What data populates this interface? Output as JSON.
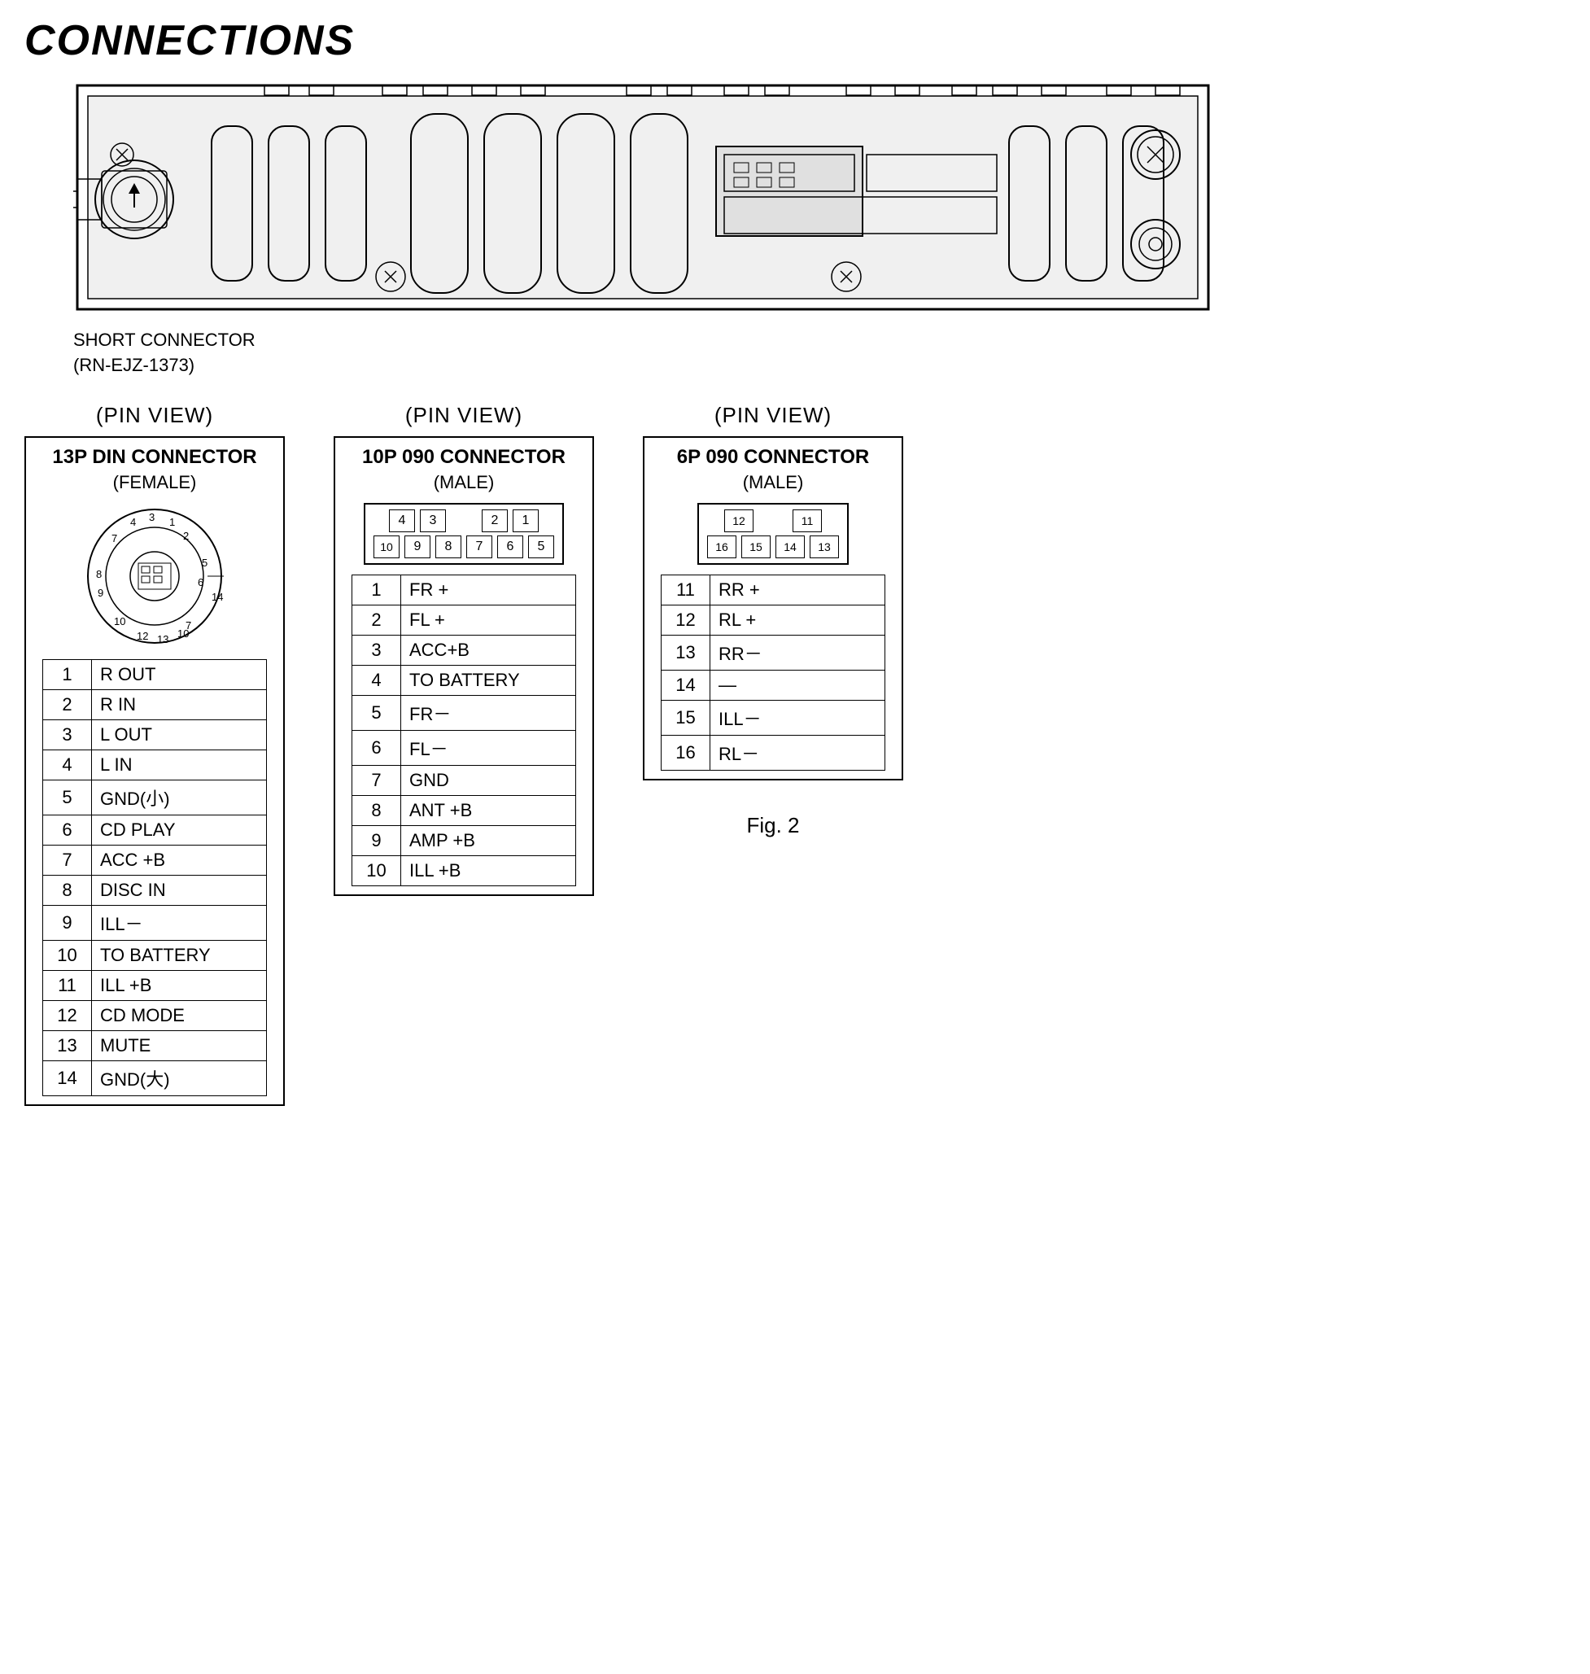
{
  "title": "CONNECTIONS",
  "short_connector_label": "SHORT CONNECTOR",
  "short_connector_code": "(RN-EJZ-1373)",
  "pin_view_label": "(PIN  VIEW)",
  "connector13p": {
    "title": "13P DIN CONNECTOR",
    "subtitle": "(FEMALE)",
    "pins": [
      {
        "num": "1",
        "label": "R OUT"
      },
      {
        "num": "2",
        "label": "R IN"
      },
      {
        "num": "3",
        "label": "L OUT"
      },
      {
        "num": "4",
        "label": "L IN"
      },
      {
        "num": "5",
        "label": "GND(小)"
      },
      {
        "num": "6",
        "label": "CD PLAY"
      },
      {
        "num": "7",
        "label": "ACC +B"
      },
      {
        "num": "8",
        "label": "DISC IN"
      },
      {
        "num": "9",
        "label": "ILL－"
      },
      {
        "num": "10",
        "label": "TO BATTERY"
      },
      {
        "num": "11",
        "label": "ILL +B"
      },
      {
        "num": "12",
        "label": "CD MODE"
      },
      {
        "num": "13",
        "label": "MUTE"
      },
      {
        "num": "14",
        "label": "GND(大)"
      }
    ]
  },
  "connector10p": {
    "title": "10P 090 CONNECTOR",
    "subtitle": "(MALE)",
    "grid_top": [
      "4",
      "3",
      "",
      "2",
      "1"
    ],
    "grid_bottom": [
      "10",
      "9",
      "8",
      "7",
      "6",
      "5"
    ],
    "pins": [
      {
        "num": "1",
        "label": "FR +"
      },
      {
        "num": "2",
        "label": "FL +"
      },
      {
        "num": "3",
        "label": "ACC+B"
      },
      {
        "num": "4",
        "label": "TO BATTERY"
      },
      {
        "num": "5",
        "label": "FR－"
      },
      {
        "num": "6",
        "label": "FL－"
      },
      {
        "num": "7",
        "label": "GND"
      },
      {
        "num": "8",
        "label": "ANT +B"
      },
      {
        "num": "9",
        "label": "AMP +B"
      },
      {
        "num": "10",
        "label": "ILL +B"
      }
    ]
  },
  "connector6p": {
    "title": "6P 090 CONNECTOR",
    "subtitle": "(MALE)",
    "grid_top": [
      "12",
      "",
      "11"
    ],
    "grid_bottom": [
      "16",
      "15",
      "14",
      "13"
    ],
    "pins": [
      {
        "num": "11",
        "label": "RR +"
      },
      {
        "num": "12",
        "label": "RL +"
      },
      {
        "num": "13",
        "label": "RR－"
      },
      {
        "num": "14",
        "label": "—"
      },
      {
        "num": "15",
        "label": "ILL－"
      },
      {
        "num": "16",
        "label": "RL－"
      }
    ]
  },
  "fig_label": "Fig. 2"
}
